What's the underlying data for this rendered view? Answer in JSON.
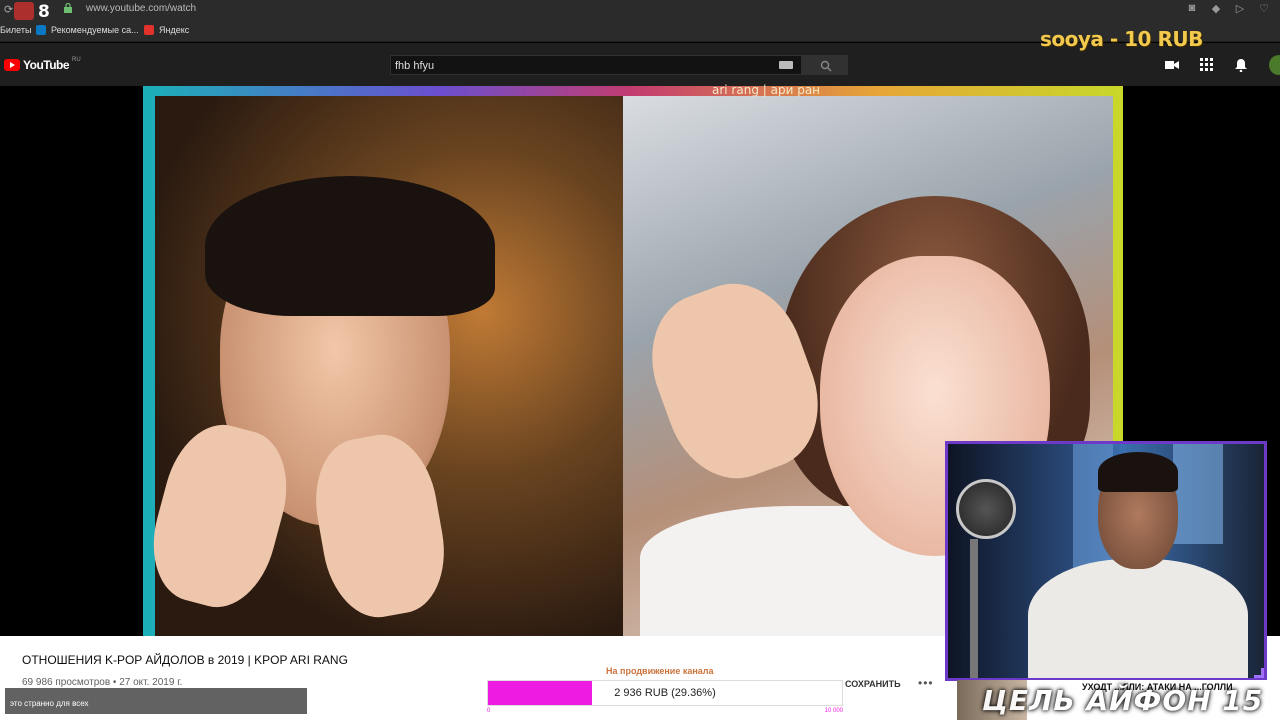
{
  "browser": {
    "tab_badge_count": "8",
    "url": "www.youtube.com/watch",
    "bookmarks": [
      {
        "label": "Билеты",
        "icon": "none"
      },
      {
        "label": "Рекомендуемые са...",
        "icon": "bing-icon"
      },
      {
        "label": "Яндекс",
        "icon": "yandex-icon"
      }
    ]
  },
  "stream_overlay": {
    "donation_alert": "sooya - 10 RUB",
    "chat": {
      "username": "",
      "message": "это странно для всех"
    },
    "goal": {
      "label": "2 936 RUB (29.36%)",
      "progress_fraction": 0.2936,
      "axis_min": "0",
      "axis_max": "10 000"
    },
    "goal_banner": "ЦЕЛЬ АЙФОН 15",
    "news_ticker": "УХОДТ ...ЛЛИ: АТАКИ НА ...ГОЛЛИ"
  },
  "youtube": {
    "logo_text": "YouTube",
    "logo_region": "RU",
    "search_value": "fhb hfyu",
    "video_overlay_caption": "ari rang | ари ран",
    "video_title": "ОТНОШЕНИЯ K-POP АЙДОЛОВ в 2019 | KPOP ARI RANG",
    "video_meta": "69 986 просмотров • 27 окт. 2019 г.",
    "promo_text": "На продвижение канала",
    "save_label": "СОХРАНИТЬ",
    "more_label": "•••"
  },
  "colors": {
    "donation": "#f2c94c",
    "goal_fill": "#ee1ce3",
    "cam_border": "#6c39c8",
    "youtube_red": "#ff0000"
  }
}
